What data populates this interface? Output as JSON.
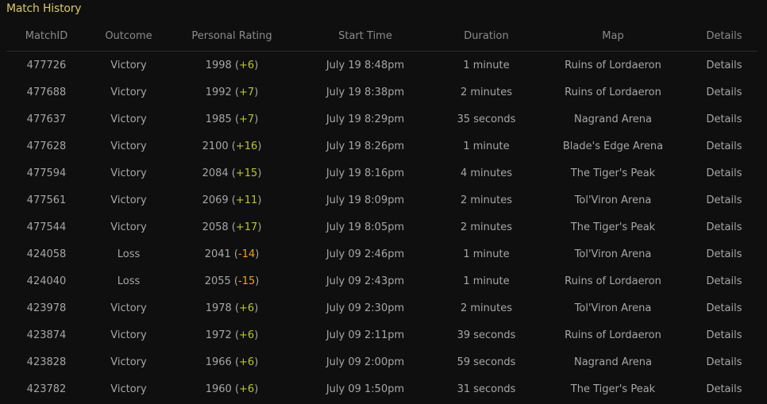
{
  "page": {
    "title": "Match History"
  },
  "colors": {
    "title": "#d8c76a",
    "gain": "#b8c435",
    "loss": "#f0a020"
  },
  "columns": {
    "match_id": "MatchID",
    "outcome": "Outcome",
    "rating": "Personal Rating",
    "start_time": "Start Time",
    "duration": "Duration",
    "map": "Map",
    "details": "Details"
  },
  "rows": [
    {
      "match_id": "477726",
      "outcome": "Victory",
      "rating": "1998",
      "change": "+6",
      "start_time": "July 19 8:48pm",
      "duration": "1 minute",
      "map": "Ruins of Lordaeron",
      "details": "Details"
    },
    {
      "match_id": "477688",
      "outcome": "Victory",
      "rating": "1992",
      "change": "+7",
      "start_time": "July 19 8:38pm",
      "duration": "2 minutes",
      "map": "Ruins of Lordaeron",
      "details": "Details"
    },
    {
      "match_id": "477637",
      "outcome": "Victory",
      "rating": "1985",
      "change": "+7",
      "start_time": "July 19 8:29pm",
      "duration": "35 seconds",
      "map": "Nagrand Arena",
      "details": "Details"
    },
    {
      "match_id": "477628",
      "outcome": "Victory",
      "rating": "2100",
      "change": "+16",
      "start_time": "July 19 8:26pm",
      "duration": "1 minute",
      "map": "Blade's Edge Arena",
      "details": "Details"
    },
    {
      "match_id": "477594",
      "outcome": "Victory",
      "rating": "2084",
      "change": "+15",
      "start_time": "July 19 8:16pm",
      "duration": "4 minutes",
      "map": "The Tiger's Peak",
      "details": "Details"
    },
    {
      "match_id": "477561",
      "outcome": "Victory",
      "rating": "2069",
      "change": "+11",
      "start_time": "July 19 8:09pm",
      "duration": "2 minutes",
      "map": "Tol'Viron Arena",
      "details": "Details"
    },
    {
      "match_id": "477544",
      "outcome": "Victory",
      "rating": "2058",
      "change": "+17",
      "start_time": "July 19 8:05pm",
      "duration": "2 minutes",
      "map": "The Tiger's Peak",
      "details": "Details"
    },
    {
      "match_id": "424058",
      "outcome": "Loss",
      "rating": "2041",
      "change": "-14",
      "start_time": "July 09 2:46pm",
      "duration": "1 minute",
      "map": "Tol'Viron Arena",
      "details": "Details"
    },
    {
      "match_id": "424040",
      "outcome": "Loss",
      "rating": "2055",
      "change": "-15",
      "start_time": "July 09 2:43pm",
      "duration": "1 minute",
      "map": "Ruins of Lordaeron",
      "details": "Details"
    },
    {
      "match_id": "423978",
      "outcome": "Victory",
      "rating": "1978",
      "change": "+6",
      "start_time": "July 09 2:30pm",
      "duration": "2 minutes",
      "map": "Tol'Viron Arena",
      "details": "Details"
    },
    {
      "match_id": "423874",
      "outcome": "Victory",
      "rating": "1972",
      "change": "+6",
      "start_time": "July 09 2:11pm",
      "duration": "39 seconds",
      "map": "Ruins of Lordaeron",
      "details": "Details"
    },
    {
      "match_id": "423828",
      "outcome": "Victory",
      "rating": "1966",
      "change": "+6",
      "start_time": "July 09 2:00pm",
      "duration": "59 seconds",
      "map": "Nagrand Arena",
      "details": "Details"
    },
    {
      "match_id": "423782",
      "outcome": "Victory",
      "rating": "1960",
      "change": "+6",
      "start_time": "July 09 1:50pm",
      "duration": "31 seconds",
      "map": "The Tiger's Peak",
      "details": "Details"
    }
  ]
}
